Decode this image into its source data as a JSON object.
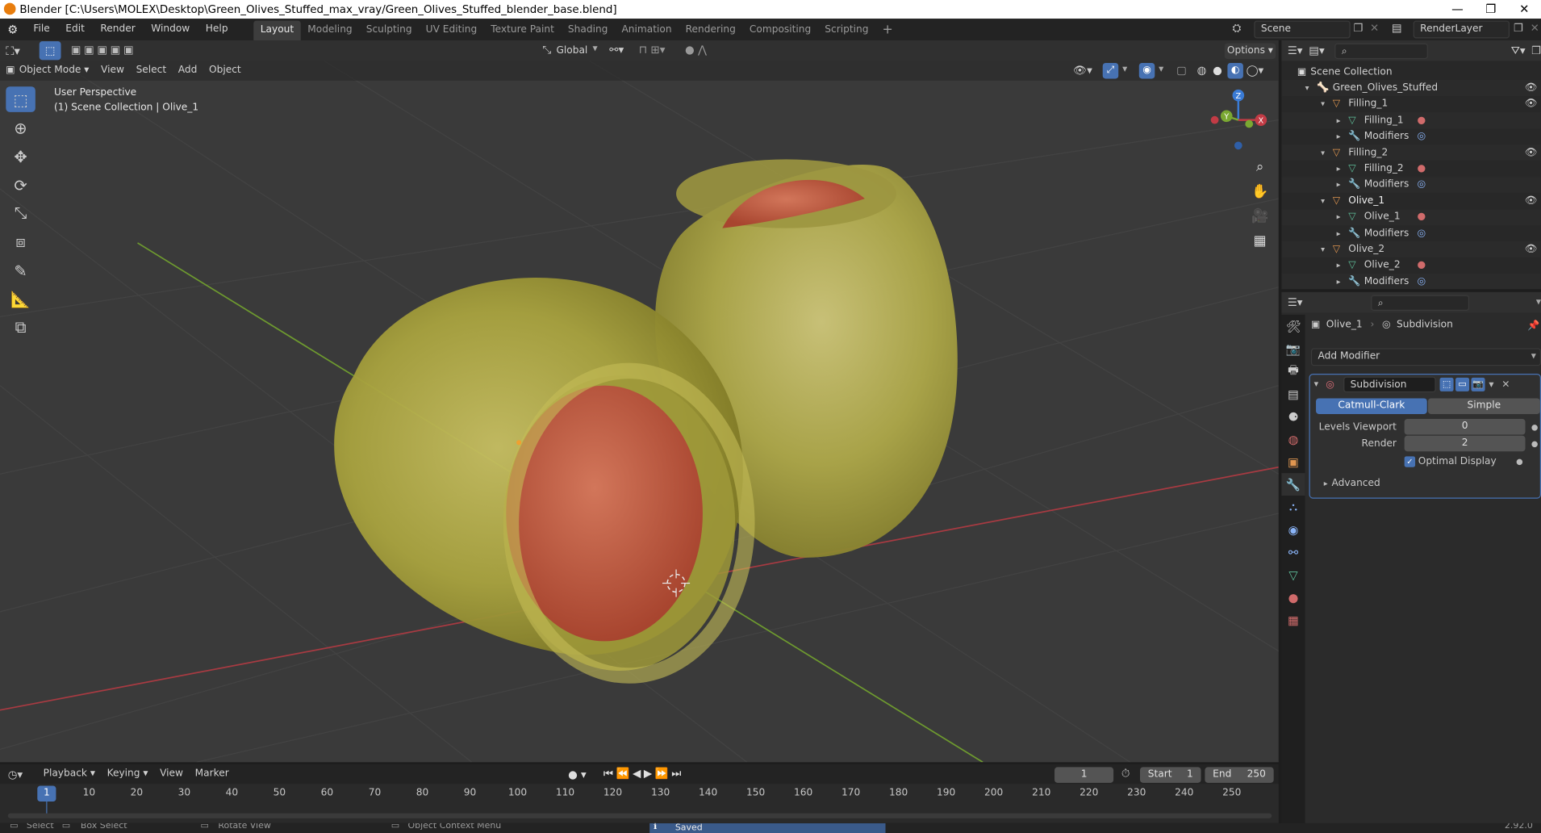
{
  "window": {
    "title": "Blender [C:\\Users\\MOLEX\\Desktop\\Green_Olives_Stuffed_max_vray/Green_Olives_Stuffed_blender_base.blend]",
    "minimize": "—",
    "restore": "❐",
    "close": "✕"
  },
  "menu": {
    "items": [
      "File",
      "Edit",
      "Render",
      "Window",
      "Help"
    ]
  },
  "workspaces": {
    "tabs": [
      "Layout",
      "Modeling",
      "Sculpting",
      "UV Editing",
      "Texture Paint",
      "Shading",
      "Animation",
      "Rendering",
      "Compositing",
      "Scripting"
    ],
    "add": "+"
  },
  "scene": {
    "name": "Scene",
    "render_layer": "RenderLayer"
  },
  "viewport": {
    "mode": "Object Mode",
    "menus": [
      "View",
      "Select",
      "Add",
      "Object"
    ],
    "orientation": "Global",
    "options": "Options",
    "overlay_line1": "User Perspective",
    "overlay_line2": "(1) Scene Collection | Olive_1",
    "gizmo": {
      "z": "Z",
      "y": "Y",
      "x": "X"
    }
  },
  "outliner": {
    "root": "Scene Collection",
    "rows": [
      {
        "label": "Green_Olives_Stuffed",
        "indent": 1,
        "arrow": "▾",
        "icon": "armature-icon",
        "glyph": "🦴",
        "color": "#e09650",
        "eye": true
      },
      {
        "label": "Filling_1",
        "indent": 2,
        "arrow": "▾",
        "icon": "object-icon",
        "glyph": "▽",
        "color": "#e09650",
        "eye": true
      },
      {
        "label": "Filling_1",
        "indent": 3,
        "arrow": "▸",
        "icon": "mesh-icon",
        "glyph": "▽",
        "color": "#5fbf9a",
        "eye": false,
        "badge": "material"
      },
      {
        "label": "Modifiers",
        "indent": 3,
        "arrow": "▸",
        "icon": "wrench-icon",
        "glyph": "🔧",
        "color": "#8aa8e0",
        "eye": false,
        "badge": "modifier"
      },
      {
        "label": "Filling_2",
        "indent": 2,
        "arrow": "▾",
        "icon": "object-icon",
        "glyph": "▽",
        "color": "#e09650",
        "eye": true
      },
      {
        "label": "Filling_2",
        "indent": 3,
        "arrow": "▸",
        "icon": "mesh-icon",
        "glyph": "▽",
        "color": "#5fbf9a",
        "eye": false,
        "badge": "material"
      },
      {
        "label": "Modifiers",
        "indent": 3,
        "arrow": "▸",
        "icon": "wrench-icon",
        "glyph": "🔧",
        "color": "#8aa8e0",
        "eye": false,
        "badge": "modifier"
      },
      {
        "label": "Olive_1",
        "indent": 2,
        "arrow": "▾",
        "icon": "object-icon",
        "glyph": "▽",
        "color": "#e09650",
        "eye": true,
        "selected": true
      },
      {
        "label": "Olive_1",
        "indent": 3,
        "arrow": "▸",
        "icon": "mesh-icon",
        "glyph": "▽",
        "color": "#5fbf9a",
        "eye": false,
        "badge": "material"
      },
      {
        "label": "Modifiers",
        "indent": 3,
        "arrow": "▸",
        "icon": "wrench-icon",
        "glyph": "🔧",
        "color": "#8aa8e0",
        "eye": false,
        "badge": "modifier"
      },
      {
        "label": "Olive_2",
        "indent": 2,
        "arrow": "▾",
        "icon": "object-icon",
        "glyph": "▽",
        "color": "#e09650",
        "eye": true
      },
      {
        "label": "Olive_2",
        "indent": 3,
        "arrow": "▸",
        "icon": "mesh-icon",
        "glyph": "▽",
        "color": "#5fbf9a",
        "eye": false,
        "badge": "material"
      },
      {
        "label": "Modifiers",
        "indent": 3,
        "arrow": "▸",
        "icon": "wrench-icon",
        "glyph": "🔧",
        "color": "#8aa8e0",
        "eye": false,
        "badge": "modifier"
      }
    ]
  },
  "properties": {
    "breadcrumb_object": "Olive_1",
    "breadcrumb_modifier": "Subdivision",
    "add_modifier": "Add Modifier",
    "modifier_name": "Subdivision",
    "algorithm_a": "Catmull-Clark",
    "algorithm_b": "Simple",
    "levels_viewport_label": "Levels Viewport",
    "levels_viewport_value": "0",
    "render_label": "Render",
    "render_value": "2",
    "optimal_display": "Optimal Display",
    "advanced": "Advanced"
  },
  "timeline": {
    "menus": [
      "Playback",
      "Keying",
      "View",
      "Marker"
    ],
    "current_frame": "1",
    "start_label": "Start",
    "start_value": "1",
    "end_label": "End",
    "end_value": "250",
    "ticks": [
      "10",
      "20",
      "30",
      "40",
      "50",
      "60",
      "70",
      "80",
      "90",
      "100",
      "110",
      "120",
      "130",
      "140",
      "150",
      "160",
      "170",
      "180",
      "190",
      "200",
      "210",
      "220",
      "230",
      "240",
      "250"
    ],
    "playhead": "1"
  },
  "status": {
    "select": "Select",
    "box_select": "Box Select",
    "rotate_view": "Rotate View",
    "context_menu": "Object Context Menu",
    "message": "Saved \"Green_Olives_Stuffed_blender_base.blend\"",
    "version": "2.92.0"
  },
  "colors": {
    "accent": "#4772b3",
    "x_axis": "#c23b45",
    "y_axis": "#7aa832",
    "z_axis": "#3a7bd5",
    "olive": "#b9b24a",
    "pimento": "#c8583a"
  }
}
